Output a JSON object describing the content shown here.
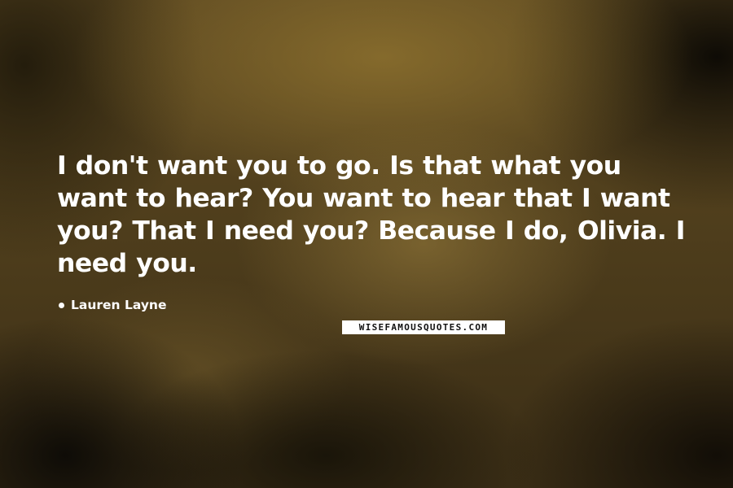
{
  "quote": {
    "text": "I don't want you to go. Is that what you want to hear? You want to hear that I want you? That I need you? Because I do, Olivia. I need you.",
    "author": "Lauren Layne"
  },
  "watermark": {
    "text": "WISEFAMOUSQUOTES.COM"
  },
  "colors": {
    "text": "#ffffff",
    "background": "#4a3a1c"
  }
}
